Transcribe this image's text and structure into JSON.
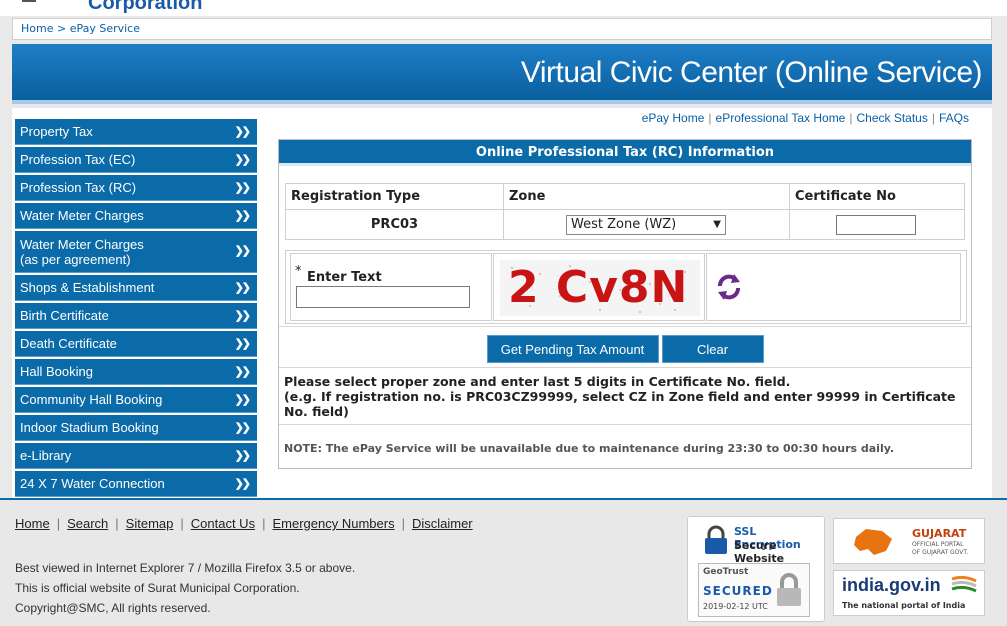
{
  "header": {
    "corp_name": "Corporation",
    "breadcrumb": "Home > ePay Service"
  },
  "banner": {
    "title": "Virtual Civic Center (Online Service)"
  },
  "sidebar": {
    "items": [
      {
        "label": "Property Tax"
      },
      {
        "label": "Profession Tax (EC)"
      },
      {
        "label": "Profession Tax (RC)"
      },
      {
        "label": "Water Meter Charges"
      },
      {
        "label": "Water Meter Charges",
        "label2": "(as per agreement)"
      },
      {
        "label": "Shops & Establishment"
      },
      {
        "label": "Birth Certificate"
      },
      {
        "label": "Death Certificate"
      },
      {
        "label": "Hall Booking"
      },
      {
        "label": "Community Hall Booking"
      },
      {
        "label": "Indoor Stadium Booking"
      },
      {
        "label": "e-Library"
      },
      {
        "label": "24 X 7 Water Connection"
      }
    ]
  },
  "top_links": [
    "ePay Home",
    "eProfessional Tax Home",
    "Check Status",
    "FAQs"
  ],
  "panel": {
    "title": "Online Professional Tax (RC) Information",
    "col_reg_type": "Registration Type",
    "col_zone": "Zone",
    "col_cert_no": "Certificate No",
    "reg_type_value": "PRC03",
    "zone_selected": "West Zone (WZ)",
    "cert_no_value": "",
    "enter_text_label": "Enter Text",
    "enter_text_star": "*",
    "enter_text_value": "",
    "captcha_text": "2 Cv8N",
    "btn_get": "Get Pending Tax Amount",
    "btn_clear": "Clear",
    "info_line1": "Please select proper zone and enter last 5 digits in Certificate No. field.",
    "info_line2": "(e.g. If registration no. is PRC03CZ99999, select CZ in Zone field and enter 99999 in Certificate No. field)",
    "note": "NOTE: The ePay Service will be unavailable due to maintenance during 23:30 to 00:30 hours daily."
  },
  "footer": {
    "links": [
      "Home",
      "Search",
      "Sitemap",
      "Contact Us",
      "Emergency Numbers",
      "Disclaimer"
    ],
    "line1": "Best viewed in Internet Explorer 7 / Mozilla Firefox 3.5 or above.",
    "line2": "This is official website of Surat Municipal Corporation.",
    "line3": "Copyright@SMC, All rights reserved."
  },
  "badges": {
    "ssl_title": "SSL Encryption",
    "ssl_sub": "Secure Website",
    "geo_brand": "GeoTrust",
    "geo_secured": "SECURED",
    "geo_date": "2019-02-12 UTC",
    "guj_title": "GUJARAT",
    "guj_sub1": "OFFICIAL PORTAL",
    "guj_sub2": "OF GUJARAT GOVT.",
    "india_title": "india.gov.in",
    "india_sub": "The national portal of India"
  },
  "colors": {
    "accent": "#0a6ba8",
    "captcha": "#c81414"
  }
}
